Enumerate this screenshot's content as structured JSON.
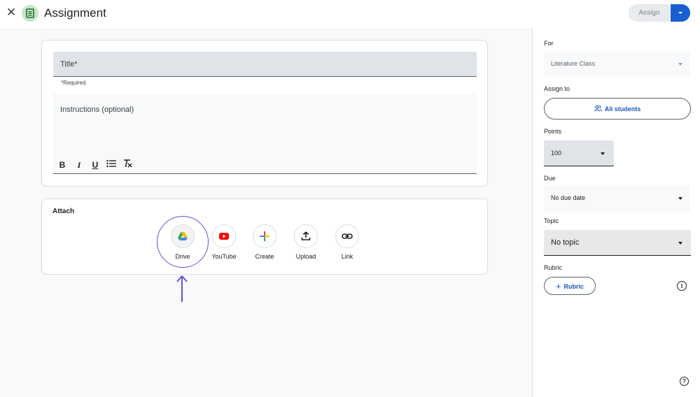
{
  "header": {
    "close_icon": "close-icon",
    "title": "Assignment",
    "assign_label": "Assign"
  },
  "form": {
    "title_placeholder": "Title*",
    "required_note": "*Required",
    "instructions_placeholder": "Instructions (optional)",
    "format_buttons": [
      "B",
      "I",
      "U"
    ]
  },
  "attach": {
    "label": "Attach",
    "items": [
      {
        "label": "Drive",
        "icon": "drive-icon"
      },
      {
        "label": "YouTube",
        "icon": "youtube-icon"
      },
      {
        "label": "Create",
        "icon": "plus-icon"
      },
      {
        "label": "Upload",
        "icon": "upload-icon"
      },
      {
        "label": "Link",
        "icon": "link-icon"
      }
    ]
  },
  "sidebar": {
    "for_label": "For",
    "for_value": "Literature Class",
    "assign_to_label": "Assign to",
    "assign_to_value": "All students",
    "points_label": "Points",
    "points_value": "100",
    "due_label": "Due",
    "due_value": "No due date",
    "topic_label": "Topic",
    "topic_value": "No topic",
    "rubric_label": "Rubric",
    "rubric_button": "Rubric"
  },
  "colors": {
    "accent": "#1a5fd0",
    "highlight": "#6a4fd0",
    "badge_green": "#c8e6c9"
  }
}
